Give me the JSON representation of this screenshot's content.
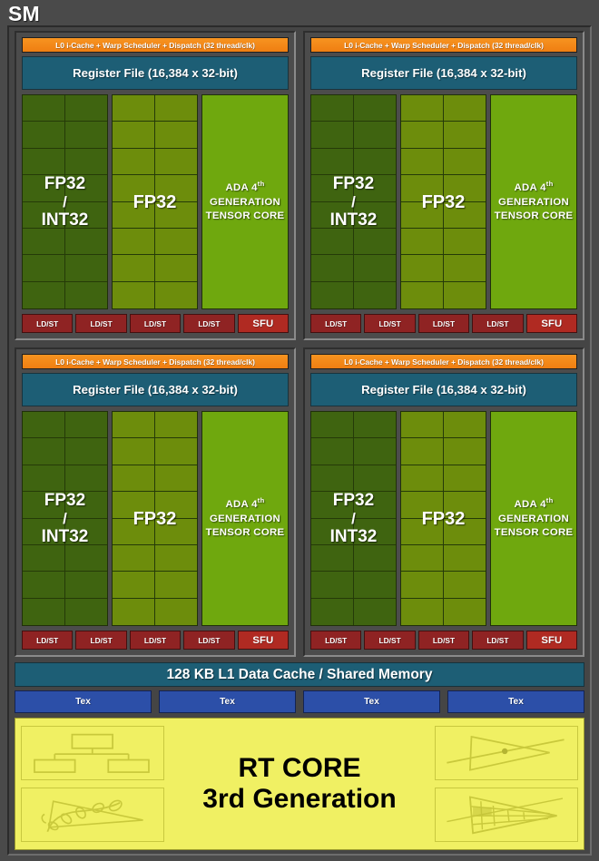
{
  "diagram": {
    "title": "SM",
    "type": "nvidia-ada-streaming-multiprocessor-block-diagram"
  },
  "processing_blocks": [
    {
      "scheduler": "L0 i-Cache + Warp Scheduler + Dispatch (32 thread/clk)",
      "register_file": "Register File (16,384 x 32-bit)",
      "int_group_label_line1": "FP32",
      "int_group_label_slash": "/",
      "int_group_label_line2": "INT32",
      "fp_group_label": "FP32",
      "tensor_line1": "ADA 4",
      "tensor_sup": "th",
      "tensor_line2": "GENERATION",
      "tensor_line3": "TENSOR CORE",
      "ldst": [
        "LD/ST",
        "LD/ST",
        "LD/ST",
        "LD/ST"
      ],
      "sfu": "SFU"
    },
    {
      "scheduler": "L0 i-Cache + Warp Scheduler + Dispatch (32 thread/clk)",
      "register_file": "Register File (16,384 x 32-bit)",
      "int_group_label_line1": "FP32",
      "int_group_label_slash": "/",
      "int_group_label_line2": "INT32",
      "fp_group_label": "FP32",
      "tensor_line1": "ADA 4",
      "tensor_sup": "th",
      "tensor_line2": "GENERATION",
      "tensor_line3": "TENSOR CORE",
      "ldst": [
        "LD/ST",
        "LD/ST",
        "LD/ST",
        "LD/ST"
      ],
      "sfu": "SFU"
    },
    {
      "scheduler": "L0 i-Cache + Warp Scheduler + Dispatch (32 thread/clk)",
      "register_file": "Register File (16,384 x 32-bit)",
      "int_group_label_line1": "FP32",
      "int_group_label_slash": "/",
      "int_group_label_line2": "INT32",
      "fp_group_label": "FP32",
      "tensor_line1": "ADA 4",
      "tensor_sup": "th",
      "tensor_line2": "GENERATION",
      "tensor_line3": "TENSOR CORE",
      "ldst": [
        "LD/ST",
        "LD/ST",
        "LD/ST",
        "LD/ST"
      ],
      "sfu": "SFU"
    },
    {
      "scheduler": "L0 i-Cache + Warp Scheduler + Dispatch (32 thread/clk)",
      "register_file": "Register File (16,384 x 32-bit)",
      "int_group_label_line1": "FP32",
      "int_group_label_slash": "/",
      "int_group_label_line2": "INT32",
      "fp_group_label": "FP32",
      "tensor_line1": "ADA 4",
      "tensor_sup": "th",
      "tensor_line2": "GENERATION",
      "tensor_line3": "TENSOR CORE",
      "ldst": [
        "LD/ST",
        "LD/ST",
        "LD/ST",
        "LD/ST"
      ],
      "sfu": "SFU"
    }
  ],
  "l1_cache": {
    "label": "128 KB L1 Data Cache / Shared Memory"
  },
  "texture_units": [
    {
      "label": "Tex"
    },
    {
      "label": "Tex"
    },
    {
      "label": "Tex"
    },
    {
      "label": "Tex"
    }
  ],
  "rt_core": {
    "title_line1": "RT CORE",
    "title_line2": "3rd Generation",
    "icons_left": [
      {
        "name": "bvh-tree-icon"
      },
      {
        "name": "opacity-micromap-foliage-icon"
      }
    ],
    "icons_right": [
      {
        "name": "ray-triangle-intersection-icon"
      },
      {
        "name": "displaced-micro-mesh-icon"
      }
    ]
  },
  "colors": {
    "background": "#4a4a4a",
    "panel": "#454545",
    "scheduler_orange": "#f79420",
    "register_file_teal": "#1d5e75",
    "fp32_int32_dark_green": "#3f6410",
    "fp32_olive_green": "#6d8d0c",
    "tensor_core_green": "#6fa80e",
    "ldst_dark_red": "#8f2323",
    "sfu_red": "#b02a22",
    "tex_blue": "#2c4fa8",
    "rt_core_yellow": "#f0f063",
    "text_white": "#ffffff",
    "text_black": "#000000"
  }
}
